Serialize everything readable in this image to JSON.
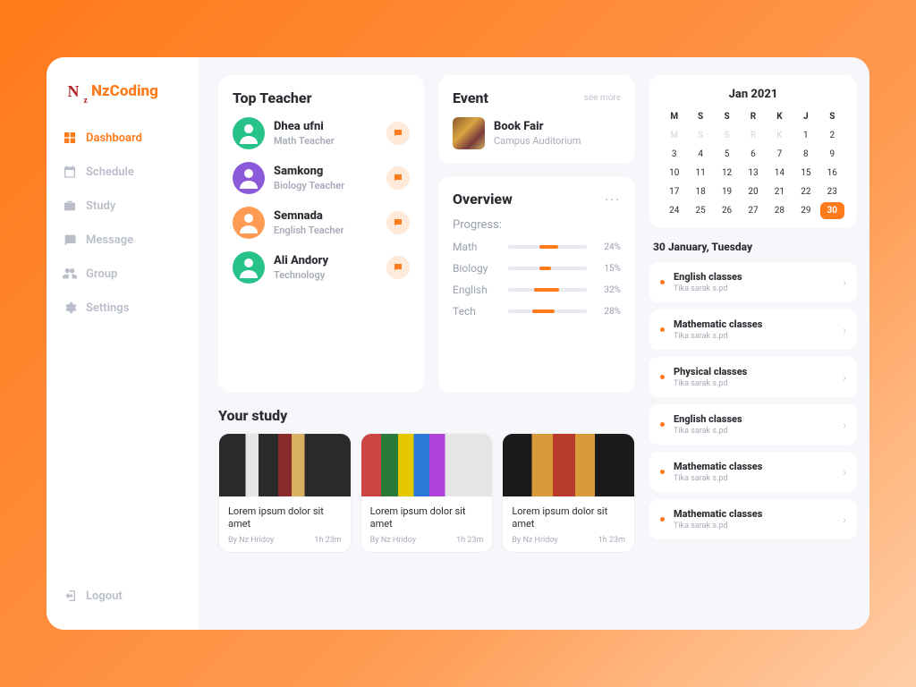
{
  "brand": "NzCoding",
  "sidebar": {
    "items": [
      {
        "label": "Dashboard",
        "icon": "grid-icon",
        "active": true
      },
      {
        "label": "Schedule",
        "icon": "calendar-icon",
        "active": false
      },
      {
        "label": "Study",
        "icon": "briefcase-icon",
        "active": false
      },
      {
        "label": "Message",
        "icon": "message-icon",
        "active": false
      },
      {
        "label": "Group",
        "icon": "users-icon",
        "active": false
      },
      {
        "label": "Settings",
        "icon": "gear-icon",
        "active": false
      }
    ],
    "logout": "Logout"
  },
  "top_teacher": {
    "title": "Top Teacher",
    "teachers": [
      {
        "name": "Dhea ufni",
        "role": "Math Teacher",
        "avatar_color": "#27c28a"
      },
      {
        "name": "Samkong",
        "role": "Biology Teacher",
        "avatar_color": "#8a5ad9"
      },
      {
        "name": "Semnada",
        "role": "English Teacher",
        "avatar_color": "#ff9b52"
      },
      {
        "name": "Ali Andory",
        "role": "Technology",
        "avatar_color": "#27c28a"
      }
    ]
  },
  "event": {
    "title": "Event",
    "see_more": "see more",
    "name": "Book Fair",
    "location": "Campus Auditorium"
  },
  "overview": {
    "title": "Overview",
    "subtitle": "Progress:",
    "rows": [
      {
        "label": "Math",
        "pct": 24
      },
      {
        "label": "Biology",
        "pct": 15
      },
      {
        "label": "English",
        "pct": 32
      },
      {
        "label": "Tech",
        "pct": 28
      }
    ]
  },
  "study": {
    "title": "Your study",
    "cards": [
      {
        "title": "Lorem ipsum dolor sit amet",
        "by": "By Nz Hridoy",
        "dur": "1h 23m"
      },
      {
        "title": "Lorem ipsum dolor sit amet",
        "by": "By Nz Hridoy",
        "dur": "1h 23m"
      },
      {
        "title": "Lorem ipsum dolor sit amet",
        "by": "By Nz Hridoy",
        "dur": "1h 23m"
      }
    ]
  },
  "calendar": {
    "title": "Jan 2021",
    "head": [
      "M",
      "S",
      "S",
      "R",
      "K",
      "J",
      "S"
    ],
    "head2": [
      "M",
      "S",
      "S",
      "R",
      "K"
    ],
    "days": [
      1,
      2,
      3,
      4,
      5,
      6,
      7,
      8,
      9,
      10,
      11,
      12,
      13,
      14,
      15,
      16,
      17,
      18,
      19,
      20,
      21,
      22,
      23,
      24,
      25,
      26,
      27,
      28,
      29,
      30
    ],
    "selected": 30
  },
  "agenda": {
    "date": "30 January, Tuesday",
    "items": [
      {
        "name": "English classes",
        "sub": "Tika sarak s.pd"
      },
      {
        "name": "Mathematic classes",
        "sub": "Tika sarak s.pd"
      },
      {
        "name": "Physical classes",
        "sub": "Tika sarak s.pd"
      },
      {
        "name": "English classes",
        "sub": "Tika sarak s.pd"
      },
      {
        "name": "Mathematic classes",
        "sub": "Tika sarak s.pd"
      },
      {
        "name": "Mathematic classes",
        "sub": "Tika sarak s.pd"
      }
    ]
  }
}
